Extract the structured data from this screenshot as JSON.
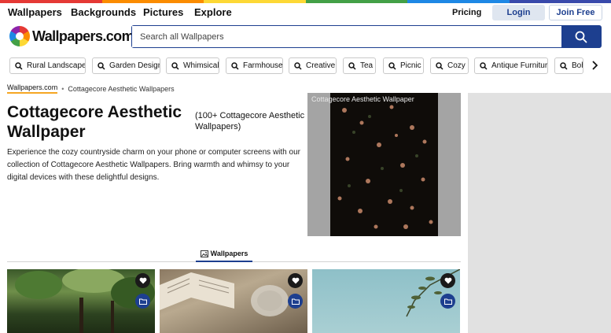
{
  "brand": {
    "name": "Wallpapers.com",
    "stripe_colors": [
      "#e53935",
      "#fb8c00",
      "#fdd835",
      "#43a047",
      "#1e88e5",
      "#3949ab"
    ]
  },
  "topnav": {
    "links": [
      "Wallpapers",
      "Backgrounds",
      "Pictures",
      "Explore"
    ],
    "pricing": "Pricing",
    "login": "Login",
    "join": "Join Free"
  },
  "search": {
    "placeholder": "Search all Wallpapers",
    "icon": "search-icon"
  },
  "chips": [
    "Rural Landscapes",
    "Garden Design",
    "Whimsical",
    "Farmhouse",
    "Creative",
    "Tea",
    "Picnic",
    "Cozy",
    "Antique Furniture",
    "Boho"
  ],
  "breadcrumb": {
    "home": "Wallpapers.com",
    "separator": "•",
    "current": "Cottagecore Aesthetic Wallpapers"
  },
  "page": {
    "title": "Cottagecore Aesthetic Wallpaper",
    "count": "(100+ Cottagecore Aesthetic Wallpapers)",
    "description": "Experience the cozy countryside charm on your phone or computer screens with our collection of Cottagecore Aesthetic Wallpapers. Bring warmth and whimsy to your digital devices with these delightful designs."
  },
  "preview": {
    "label": "Cottagecore Aesthetic Wallpaper"
  },
  "tabs": [
    {
      "label": "Wallpapers",
      "icon": "image-icon",
      "active": true
    }
  ],
  "thumbnails": [
    {
      "subject": "forest",
      "fav_icon": "heart-icon",
      "folder_icon": "folder-icon"
    },
    {
      "subject": "open-book-and-glass",
      "fav_icon": "heart-icon",
      "folder_icon": "folder-icon"
    },
    {
      "subject": "sky-with-branches",
      "fav_icon": "heart-icon",
      "folder_icon": "folder-icon"
    }
  ],
  "colors": {
    "accent": "#1d3f8f",
    "crumb_underline": "#f5a623",
    "login_bg": "#dfe6f0"
  }
}
